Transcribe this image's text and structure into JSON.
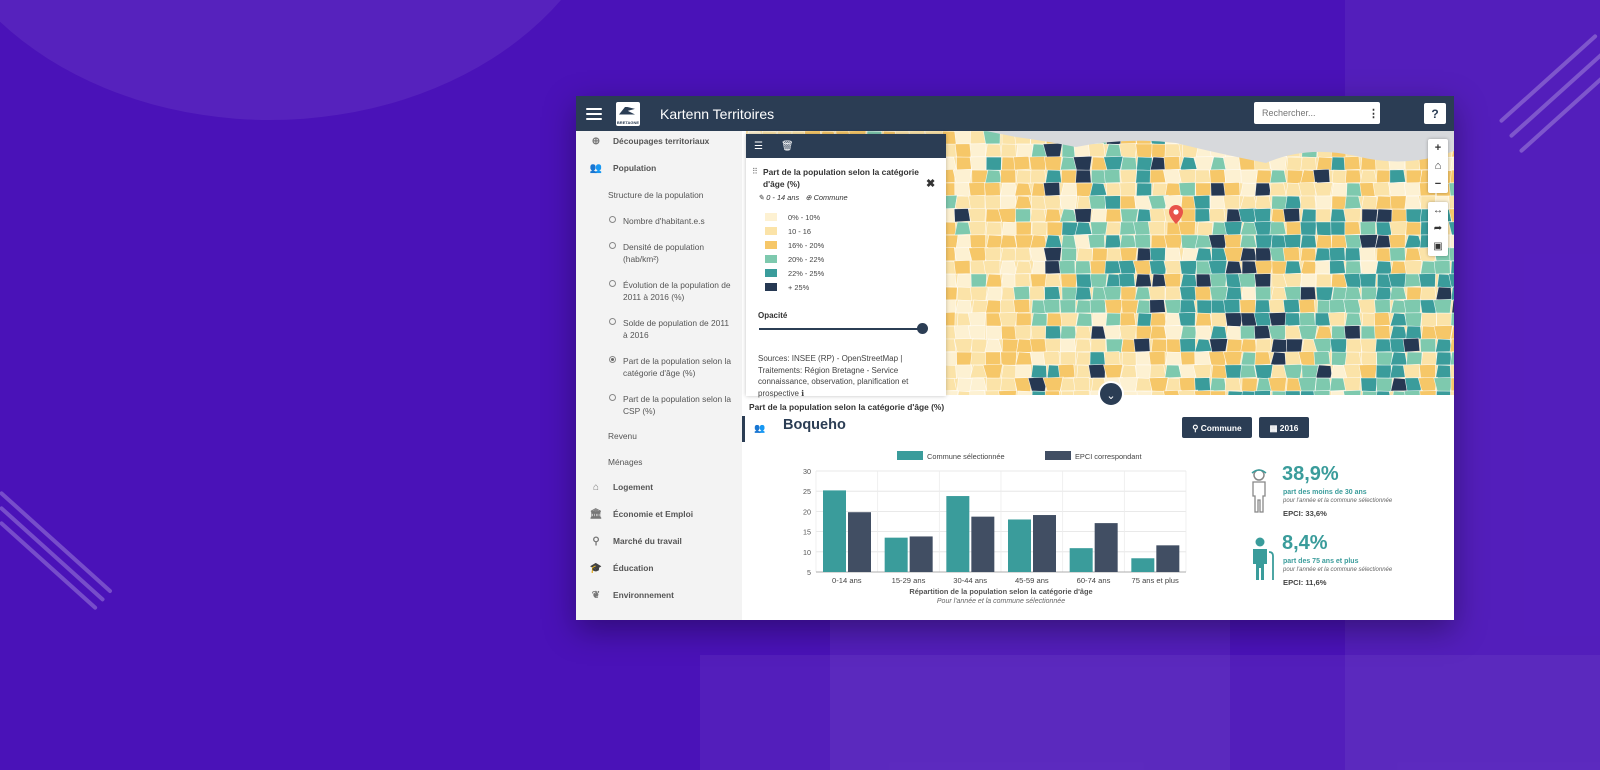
{
  "app": {
    "title": "Kartenn Territoires",
    "logo_text": "BRETAGNE",
    "help_label": "?"
  },
  "search": {
    "placeholder": "Rechercher...",
    "menu_label": "⋮"
  },
  "sidebar": {
    "items": [
      {
        "label": "Découpages territoriaux",
        "kind": "cat",
        "icon": "globe-icon"
      },
      {
        "label": "Population",
        "kind": "cat",
        "icon": "users-icon"
      },
      {
        "label": "Structure de la population",
        "kind": "sub"
      },
      {
        "label": "Nombre d'habitant.e.s",
        "kind": "radio"
      },
      {
        "label": "Densité de population (hab/km²)",
        "kind": "radio"
      },
      {
        "label": "Évolution de la population de 2011 à 2016 (%)",
        "kind": "radio"
      },
      {
        "label": "Solde de population de 2011 à 2016",
        "kind": "radio"
      },
      {
        "label": "Part de la population selon la catégorie d'âge (%)",
        "kind": "radio",
        "selected": true
      },
      {
        "label": "Part de la population selon la CSP (%)",
        "kind": "radio"
      },
      {
        "label": "Revenu",
        "kind": "sub"
      },
      {
        "label": "Ménages",
        "kind": "sub"
      },
      {
        "label": "Logement",
        "kind": "cat",
        "icon": "home-icon"
      },
      {
        "label": "Économie et Emploi",
        "kind": "cat",
        "icon": "bank-icon"
      },
      {
        "label": "Marché du travail",
        "kind": "cat",
        "icon": "search-icon"
      },
      {
        "label": "Éducation",
        "kind": "cat",
        "icon": "graduation-cap-icon"
      },
      {
        "label": "Environnement",
        "kind": "cat",
        "icon": "leaf-icon"
      }
    ]
  },
  "legend": {
    "title": "Part de la population selon la catégorie d'âge (%)",
    "meta_age": "0 - 14 ans",
    "meta_level": "Commune",
    "classes": [
      {
        "label": "0% - 10%",
        "color": "#fdf1d2"
      },
      {
        "label": "10 - 16",
        "color": "#fbe3a8"
      },
      {
        "label": "16% - 20%",
        "color": "#f6c768"
      },
      {
        "label": "20% - 22%",
        "color": "#7ec9ae"
      },
      {
        "label": "22% - 25%",
        "color": "#3a9c9b"
      },
      {
        "label": "+ 25%",
        "color": "#263852"
      }
    ],
    "opacity_label": "Opacité",
    "opacity_value": 1,
    "sources": "Sources: INSEE (RP) - OpenStreetMap | Traitements: Région Bretagne - Service connaissance, observation, planification et prospective"
  },
  "panel": {
    "title": "Part de la population selon la catégorie d'âge (%)",
    "commune": "Boqueho",
    "btn_commune": "Commune",
    "btn_year": "2016"
  },
  "colors": {
    "dark": "#2b3d54",
    "teal": "#3a9c9b",
    "series2": "#414e63"
  },
  "chart_data": {
    "type": "bar",
    "title": "Répartition de la population selon la catégorie d'âge",
    "subtitle": "Pour l'année et la commune sélectionnée",
    "categories": [
      "0-14 ans",
      "15-29 ans",
      "30-44 ans",
      "45-59 ans",
      "60-74 ans",
      "75 ans et plus"
    ],
    "series": [
      {
        "name": "Commune sélectionnée",
        "values": [
          25.2,
          13.5,
          23.8,
          18,
          10.9,
          8.4
        ]
      },
      {
        "name": "EPCI correspondant",
        "values": [
          19.8,
          13.8,
          18.7,
          19.1,
          17.1,
          11.6
        ]
      }
    ],
    "ylim": [
      5,
      30
    ],
    "yticks": [
      5,
      10,
      15,
      20,
      25,
      30
    ],
    "grid": true,
    "legend": "top"
  },
  "stats": [
    {
      "value": "38,9%",
      "desc": "part des moins de 30 ans",
      "sub": "pour l'année et la commune sélectionnée",
      "epci": "EPCI: 33,6%"
    },
    {
      "value": "8,4%",
      "desc": "part des 75 ans et plus",
      "sub": "pour l'année et la commune sélectionnée",
      "epci": "EPCI: 11,6%"
    }
  ]
}
